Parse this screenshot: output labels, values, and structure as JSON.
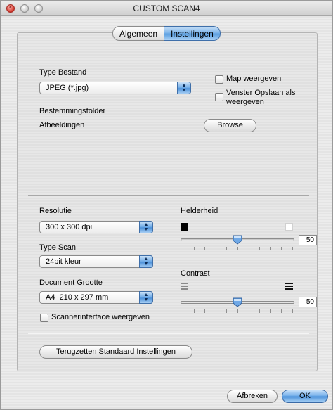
{
  "window": {
    "title": "CUSTOM SCAN4"
  },
  "tabs": {
    "general": "Algemeen",
    "settings": "Instellingen"
  },
  "file_type": {
    "label": "Type Bestand",
    "value": "JPEG (*.jpg)"
  },
  "options": {
    "show_folder": "Map weergeven",
    "show_save_window": "Venster Opslaan als weergeven"
  },
  "destination": {
    "label": "Bestemmingsfolder",
    "value": "Afbeeldingen",
    "browse": "Browse"
  },
  "resolution": {
    "label": "Resolutie",
    "value": "300 x 300 dpi"
  },
  "scan_type": {
    "label": "Type Scan",
    "value": "24bit kleur"
  },
  "doc_size": {
    "label": "Document Grootte",
    "value": "A4  210 x 297 mm"
  },
  "scanner_interface": {
    "label": "Scannerinterface weergeven"
  },
  "brightness": {
    "label": "Helderheid",
    "value": "50",
    "level": 0.5
  },
  "contrast": {
    "label": "Contrast",
    "value": "50",
    "level": 0.5
  },
  "buttons": {
    "reset": "Terugzetten Standaard Instellingen",
    "cancel": "Afbreken",
    "ok": "OK"
  }
}
